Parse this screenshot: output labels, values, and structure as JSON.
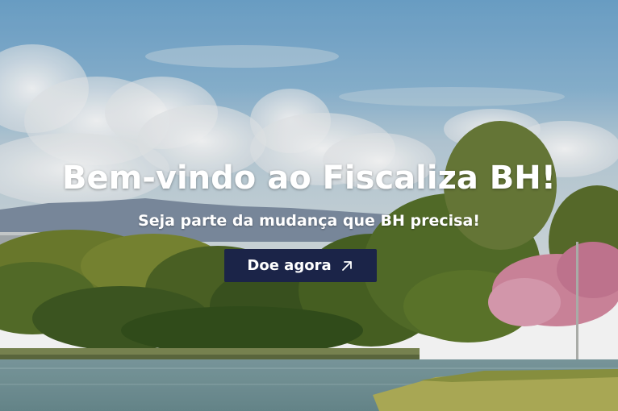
{
  "hero": {
    "title": "Bem-vindo ao Fiscaliza BH!",
    "subtitle": "Seja parte da mudança que BH precisa!",
    "cta_label": "Doe agora",
    "cta_icon": "arrow-up-right-icon",
    "background": "photo: lagoa com árvores, ipê rosa e céu com nuvens"
  },
  "colors": {
    "button_bg": "#1b2448",
    "text": "#ffffff"
  }
}
